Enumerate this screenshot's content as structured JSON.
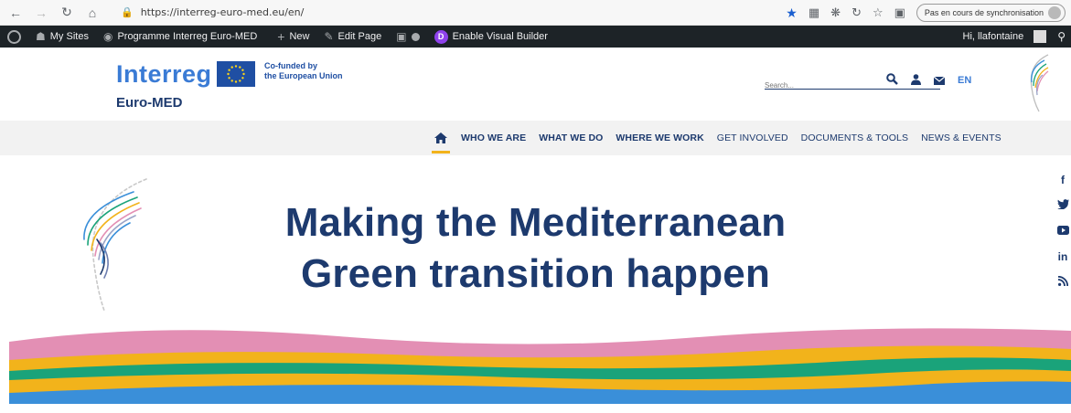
{
  "browser": {
    "url": "https://interreg-euro-med.eu/en/",
    "sync_status": "Pas en cours de synchronisation"
  },
  "admin_bar": {
    "my_sites": "My Sites",
    "site_name": "Programme Interreg Euro-MED",
    "new": "New",
    "edit_page": "Edit Page",
    "visual_builder": "Enable Visual Builder",
    "greeting": "Hi, llafontaine"
  },
  "header": {
    "logo_title": "Interreg",
    "logo_subtitle": "Euro-MED",
    "cofunded_line1": "Co-funded by",
    "cofunded_line2": "the European Union",
    "search_placeholder": "Search...",
    "language": "EN"
  },
  "menu": {
    "items": [
      {
        "label": "WHO WE ARE"
      },
      {
        "label": "WHAT WE DO"
      },
      {
        "label": "WHERE WE WORK"
      },
      {
        "label": "GET INVOLVED"
      },
      {
        "label": "DOCUMENTS & TOOLS"
      },
      {
        "label": "NEWS & EVENTS"
      }
    ]
  },
  "hero": {
    "line1": "Making the Mediterranean",
    "line2": "Green transition happen"
  },
  "colors": {
    "navy": "#1d3a6e",
    "brand_blue": "#3a7bd5",
    "accent_yellow": "#f2b31b",
    "wave_pink": "#e38fb4",
    "wave_green": "#1aa37a",
    "wave_blue": "#3a8fd9"
  },
  "icons": {
    "social": [
      "facebook-icon",
      "twitter-icon",
      "youtube-icon",
      "linkedin-icon",
      "rss-icon"
    ]
  }
}
